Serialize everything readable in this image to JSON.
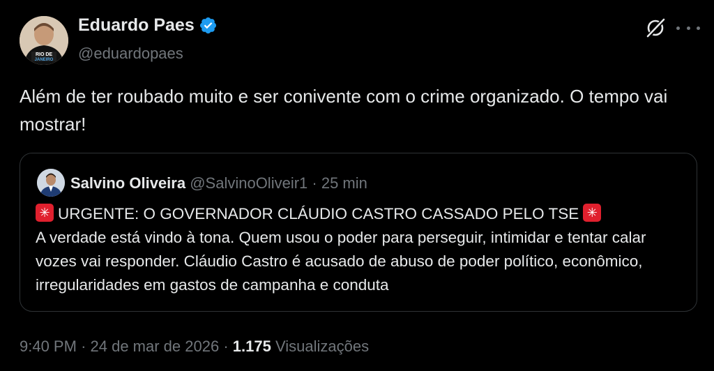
{
  "author": {
    "name": "Eduardo Paes",
    "handle": "@eduardopaes",
    "avatar_shirt_text_1": "RIO DE",
    "avatar_shirt_text_2": "JANEIRO"
  },
  "tweet": {
    "text": "Além de ter roubado muito e ser conivente com o crime organizado.  O tempo vai mostrar!"
  },
  "quote": {
    "name": "Salvino Oliveira",
    "handle": "@SalvinoOliveir1",
    "separator": "·",
    "time": "25 min",
    "headline": "URGENTE: O GOVERNADOR CLÁUDIO CASTRO CASSADO PELO TSE",
    "body": "A verdade está vindo à tona. Quem usou o poder para perseguir, intimidar e tentar calar vozes vai responder. Cláudio Castro é acusado de abuso de poder político, econômico, irregularidades em gastos de campanha e conduta"
  },
  "footer": {
    "time": "9:40 PM",
    "separator": "·",
    "date": "24 de mar de 2026",
    "views_count": "1.175",
    "views_label": "Visualizações"
  },
  "icons": {
    "verified": "verified-badge-icon",
    "grok": "grok-icon",
    "more": "more-icon",
    "siren": "siren-emoji-icon"
  },
  "colors": {
    "background": "#000000",
    "text": "#e7e9ea",
    "muted": "#71767b",
    "verified": "#1d9bf0",
    "border": "#2f3336",
    "siren": "#e0202e"
  }
}
